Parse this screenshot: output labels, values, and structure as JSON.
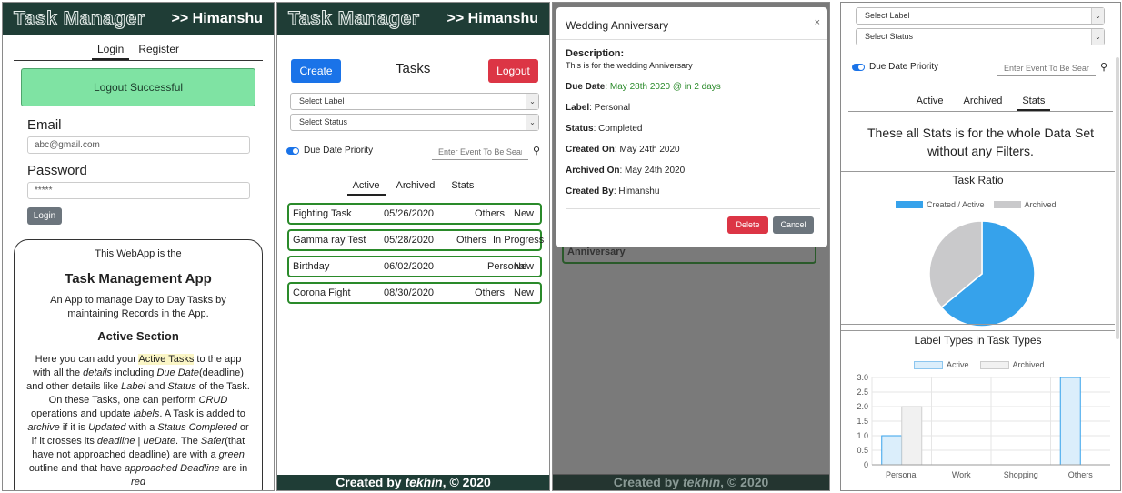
{
  "app": {
    "brand": "Task Manager",
    "user": ">> Himanshu",
    "footer_prefix": "Created by ",
    "footer_name": "tekhin",
    "footer_suffix": ", © 2020"
  },
  "login_screen": {
    "tabs": [
      "Login",
      "Register"
    ],
    "alert": "Logout Successful",
    "email_label": "Email",
    "email_value": "abc@gmail.com",
    "password_label": "Password",
    "password_value": "*****",
    "login_button": "Login",
    "info": {
      "intro": "This WebApp is the",
      "title": "Task Management App",
      "desc": "An App to manage Day to Day Tasks by maintaining Records in the App.",
      "section": "Active Section",
      "p1": "Here you can add your ",
      "p1_highlight": "Active Tasks",
      "p2": " to the app with all the ",
      "details": "details",
      "p3": " including ",
      "due_date": "Due Date",
      "p4": "(deadline) and other details like ",
      "label": "Label",
      "p5": " and ",
      "status": "Status",
      "p6": " of the Task. On these Tasks, one can perform ",
      "crud": "CRUD",
      "p7": " operations and update ",
      "labels": "labels",
      "p8": ". A Task is added to ",
      "archive": "archive",
      "p9": " if it is ",
      "updated": "Updated",
      "p10": " with a ",
      "status_completed": "Status Completed",
      "p11": " or if it crosses its ",
      "deadline": "deadline",
      "p12": " | ",
      "uedate": "ueDate",
      "p13": ". The ",
      "safer": "Safer",
      "p14": "(that have not approached deadline) are with a ",
      "green": "green",
      "p15": " outline and that have ",
      "approached": "approached Deadline",
      "p16": " are in ",
      "red": "red"
    }
  },
  "tasks_screen": {
    "create": "Create",
    "title": "Tasks",
    "logout": "Logout",
    "select_label": "Select Label",
    "select_status": "Select Status",
    "priority": "Due Date Priority",
    "search_placeholder": "Enter Event To Be Searched",
    "tabs": [
      "Active",
      "Archived",
      "Stats"
    ],
    "tasks": [
      {
        "name": "Fighting Task",
        "date": "05/26/2020",
        "label": "Others",
        "status": "New"
      },
      {
        "name": "Gamma ray Test",
        "date": "05/28/2020",
        "label": "Others",
        "status": "In Progress"
      },
      {
        "name": "Birthday",
        "date": "06/02/2020",
        "label": "Personal",
        "status": "New"
      },
      {
        "name": "Corona Fight",
        "date": "08/30/2020",
        "label": "Others",
        "status": "New"
      }
    ]
  },
  "modal": {
    "title": "Wedding Anniversary",
    "close": "×",
    "desc_label": "Description:",
    "desc": "This is for the wedding Anniversary",
    "due_label": "Due Date",
    "due_value": ": May 28th 2020 @ in 2 days",
    "label_label": "Label",
    "label_value": ": Personal",
    "status_label": "Status",
    "status_value": ": Completed",
    "created_label": "Created On",
    "created_value": ": May 24th 2020",
    "archived_label": "Archived On",
    "archived_value": ": May 24th 2020",
    "by_label": "Created By",
    "by_value": ": Himanshu",
    "delete": "Delete",
    "cancel": "Cancel",
    "bg_text": "Anniversary"
  },
  "stats_screen": {
    "select_label": "Select Label",
    "select_status": "Select Status",
    "priority": "Due Date Priority",
    "search_placeholder": "Enter Event To Be Searched",
    "tabs": [
      "Active",
      "Archived",
      "Stats"
    ],
    "note": "These all Stats is for the whole Data Set without any Filters.",
    "ratio_title": "Task Ratio",
    "legend_created": "Created / Active",
    "legend_archived": "Archived",
    "labels_title": "Label Types in Task Types",
    "legend_active": "Active",
    "legend_archived2": "Archived"
  },
  "colors": {
    "nav": "#1f3d36",
    "alert": "#7fe3a3",
    "create": "#1a73e8",
    "logout": "#dc3545",
    "pie_active": "#36a2eb",
    "pie_archived": "#c9c9cb",
    "green": "#2a8a2a"
  },
  "chart_data": [
    {
      "type": "pie",
      "title": "Task Ratio",
      "categories": [
        "Created / Active",
        "Archived"
      ],
      "values": [
        64,
        36
      ]
    },
    {
      "type": "bar",
      "title": "Label Types in Task Types",
      "categories": [
        "Personal",
        "Work",
        "Shopping",
        "Others"
      ],
      "series": [
        {
          "name": "Active",
          "values": [
            1,
            0,
            0,
            3
          ]
        },
        {
          "name": "Archived",
          "values": [
            2,
            0,
            0,
            0
          ]
        }
      ],
      "ylim": [
        0,
        3
      ],
      "yticks": [
        "3.0",
        "2.5",
        "2.0",
        "1.5",
        "1.0",
        "0.5",
        "0"
      ]
    }
  ]
}
